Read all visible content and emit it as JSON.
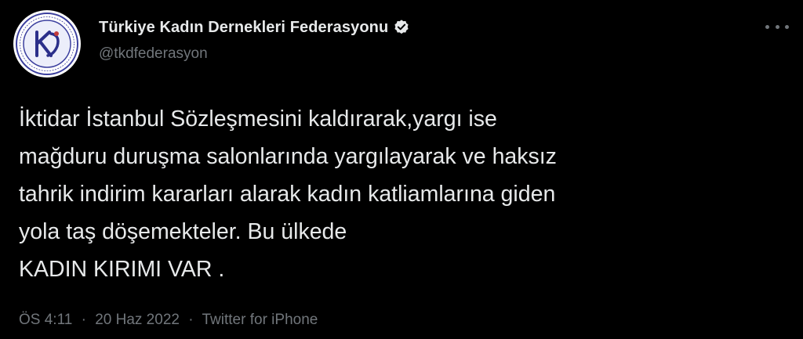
{
  "author": {
    "display_name": "Türkiye Kadın Dernekleri Federasyonu",
    "handle": "@tkdfederasyon",
    "verified": true,
    "verified_icon": "verified-badge-icon",
    "avatar_icon": "tkdf-logo"
  },
  "tweet": {
    "lines": [
      "İktidar İstanbul Sözleşmesini kaldırarak,yargı ise",
      "mağduru duruşma salonlarında yargılayarak ve haksız",
      "tahrik indirim kararları alarak kadın katliamlarına giden",
      "yola taş döşemekteler. Bu ülkede",
      "KADIN KIRIMI VAR ."
    ]
  },
  "meta": {
    "time": "ÖS 4:11",
    "date": "20 Haz 2022",
    "source": "Twitter for iPhone",
    "separator": "·"
  },
  "colors": {
    "background": "#000000",
    "text": "#e7e9ea",
    "secondary": "#71767b"
  }
}
